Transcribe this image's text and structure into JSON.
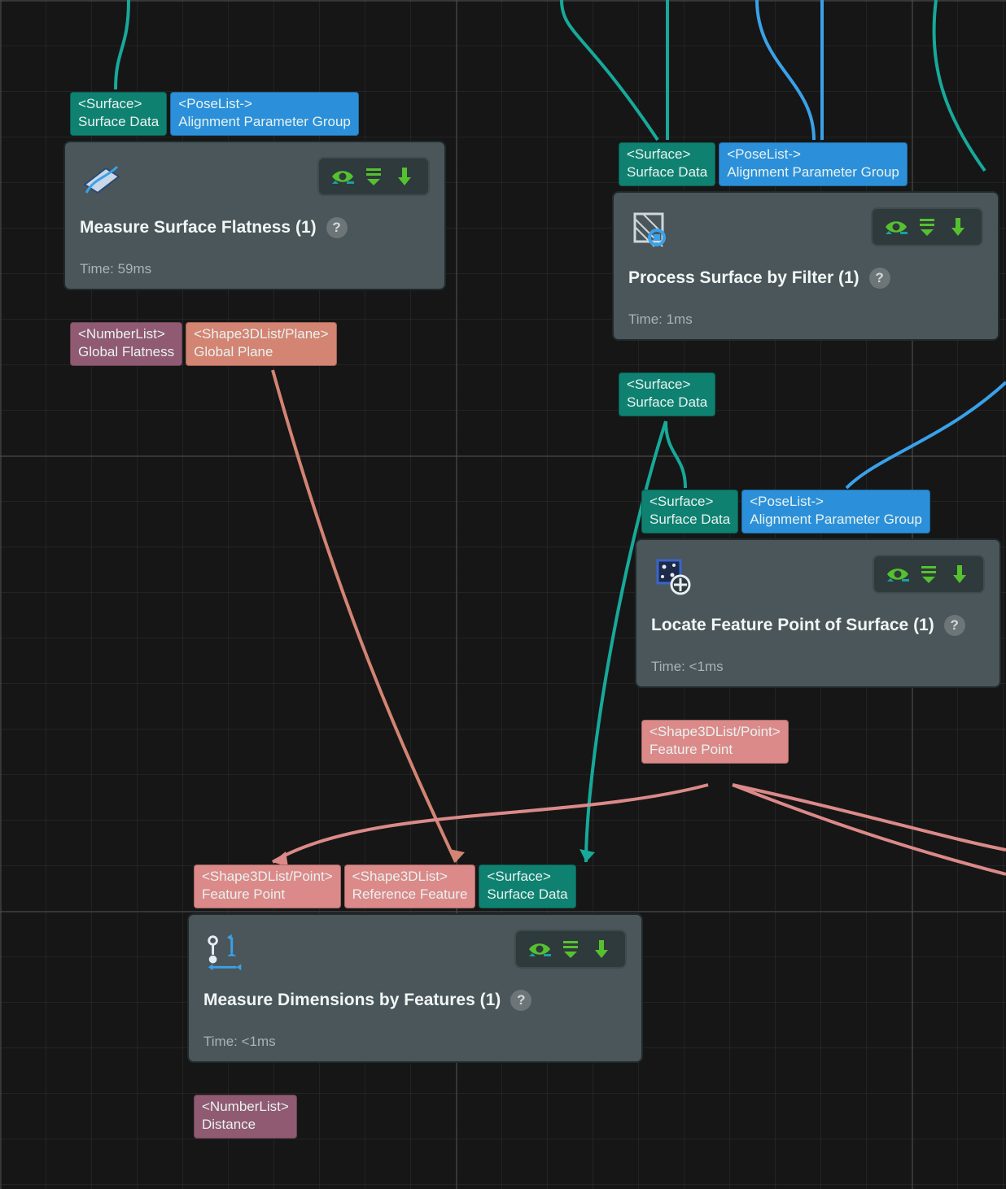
{
  "colors": {
    "teal": "#0f8171",
    "blue": "#2b90d9",
    "plum": "#8f5a72",
    "salmon": "#d38472",
    "pink": "#db8a89",
    "nodeBg": "#4a5659",
    "green": "#56c12f"
  },
  "ports": {
    "surface": {
      "type": "<Surface>",
      "label": "Surface Data"
    },
    "poseList": {
      "type": "<PoseList->",
      "label": "Alignment Parameter Group"
    },
    "numberListFlatness": {
      "type": "<NumberList>",
      "label": "Global Flatness"
    },
    "shapePlane": {
      "type": "<Shape3DList/Plane>",
      "label": "Global Plane"
    },
    "shapePointFeature": {
      "type": "<Shape3DList/Point>",
      "label": "Feature Point"
    },
    "shapeReference": {
      "type": "<Shape3DList>",
      "label": "Reference Feature"
    },
    "numberListDistance": {
      "type": "<NumberList>",
      "label": "Distance"
    }
  },
  "nodes": {
    "flatness": {
      "title": "Measure Surface Flatness (1)",
      "time": "Time: 59ms"
    },
    "filter": {
      "title": "Process Surface by Filter (1)",
      "time": "Time: 1ms"
    },
    "locate": {
      "title": "Locate Feature Point of Surface (1)",
      "time": "Time: <1ms"
    },
    "dims": {
      "title": "Measure Dimensions by Features (1)",
      "time": "Time: <1ms"
    }
  },
  "help": "?"
}
